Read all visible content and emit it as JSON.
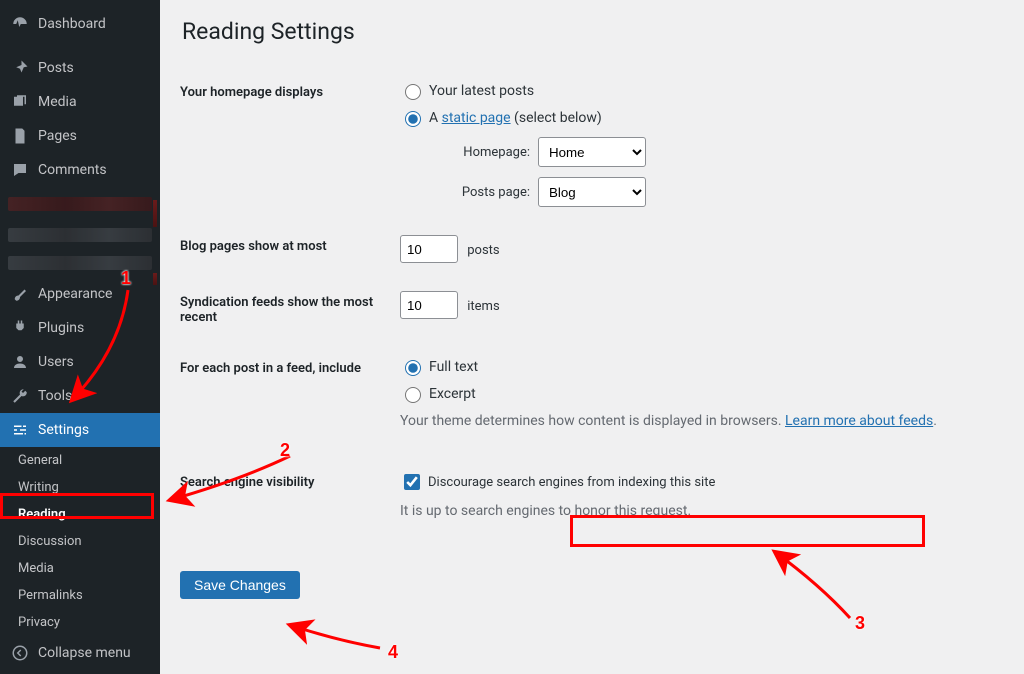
{
  "sidebar": {
    "dashboard": "Dashboard",
    "posts": "Posts",
    "media": "Media",
    "pages": "Pages",
    "comments": "Comments",
    "appearance": "Appearance",
    "plugins": "Plugins",
    "users": "Users",
    "tools": "Tools",
    "settings": "Settings",
    "submenu": {
      "general": "General",
      "writing": "Writing",
      "reading": "Reading",
      "discussion": "Discussion",
      "media": "Media",
      "permalinks": "Permalinks",
      "privacy": "Privacy"
    },
    "collapse": "Collapse menu"
  },
  "page": {
    "title": "Reading Settings",
    "homepage_label": "Your homepage displays",
    "homepage_radio_latest": "Your latest posts",
    "homepage_radio_static_prefix": "A ",
    "homepage_radio_static_link": "static page",
    "homepage_radio_static_suffix": " (select below)",
    "homepage_select_label": "Homepage:",
    "homepage_select_value": "Home",
    "postspage_select_label": "Posts page:",
    "postspage_select_value": "Blog",
    "blog_pages_label": "Blog pages show at most",
    "blog_pages_value": "10",
    "blog_pages_unit": "posts",
    "syndication_label": "Syndication feeds show the most recent",
    "syndication_value": "10",
    "syndication_unit": "items",
    "feed_include_label": "For each post in a feed, include",
    "feed_include_full": "Full text",
    "feed_include_excerpt": "Excerpt",
    "feed_include_hint_pre": "Your theme determines how content is displayed in browsers. ",
    "feed_include_hint_link": "Learn more about feeds",
    "feed_include_hint_post": ".",
    "sev_label": "Search engine visibility",
    "sev_checkbox": "Discourage search engines from indexing this site",
    "sev_hint": "It is up to search engines to honor this request.",
    "save_button": "Save Changes"
  },
  "annotations": {
    "n1": "1",
    "n2": "2",
    "n3": "3",
    "n4": "4"
  }
}
